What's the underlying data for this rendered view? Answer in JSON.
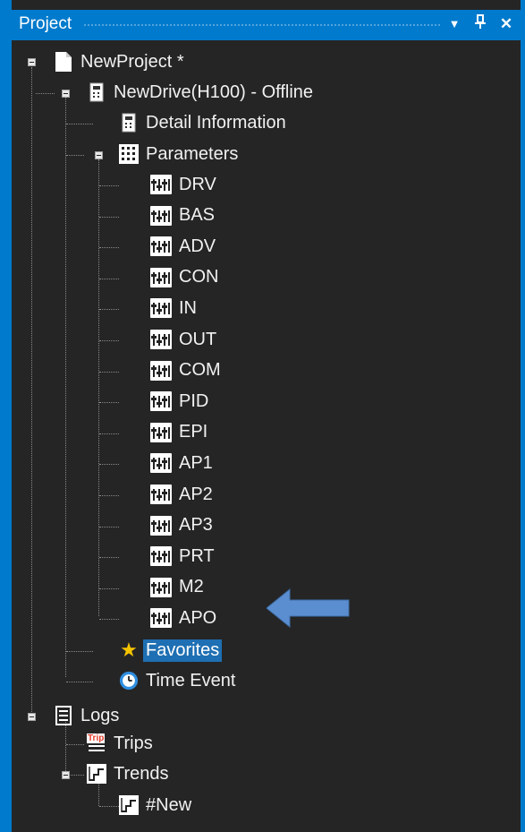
{
  "panel": {
    "title": "Project",
    "dropdown_icon": "▼",
    "pin_icon": "⊥",
    "close_icon": "✕"
  },
  "tree": {
    "project": "NewProject *",
    "drive": "NewDrive(H100) - Offline",
    "detail": "Detail Information",
    "parameters": "Parameters",
    "groups": [
      "DRV",
      "BAS",
      "ADV",
      "CON",
      "IN",
      "OUT",
      "COM",
      "PID",
      "EPI",
      "AP1",
      "AP2",
      "AP3",
      "PRT",
      "M2",
      "APO"
    ],
    "favorites": "Favorites",
    "time_event": "Time Event",
    "logs": "Logs",
    "trips": "Trips",
    "trip_icon_text": "Trip",
    "trends": "Trends",
    "new_trend": "#New"
  },
  "colors": {
    "accent": "#007acc",
    "selection": "#1e6fb3",
    "arrow": "#5b8ed0"
  }
}
